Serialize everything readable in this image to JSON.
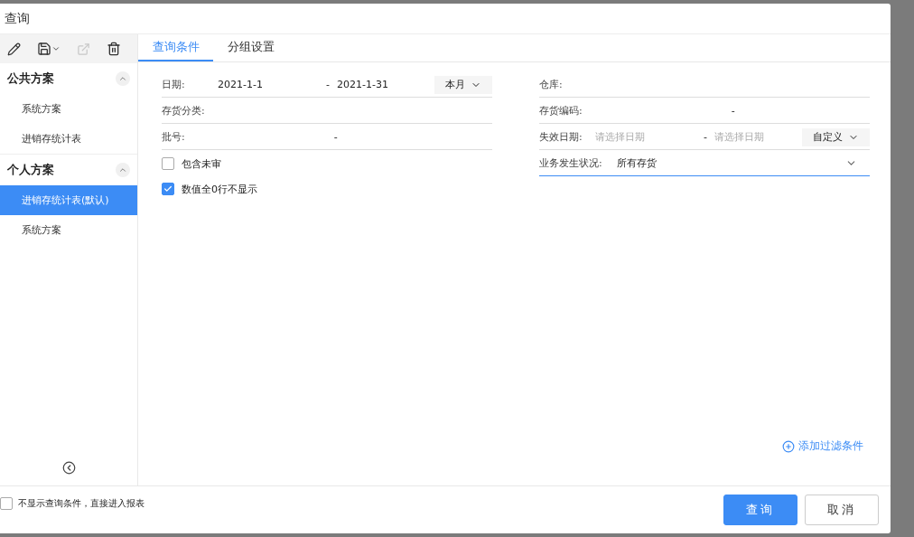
{
  "title": "查询",
  "toolbar": [
    {
      "kind": "edit",
      "disabled": false
    },
    {
      "kind": "save",
      "disabled": false
    },
    {
      "kind": "export",
      "disabled": true
    },
    {
      "kind": "delete",
      "disabled": false
    }
  ],
  "sidebar": {
    "groups": [
      {
        "title": "公共方案",
        "expanded": true,
        "items": [
          {
            "label": "系统方案",
            "selected": false
          },
          {
            "label": "进销存统计表",
            "selected": false
          }
        ]
      },
      {
        "title": "个人方案",
        "expanded": true,
        "items": [
          {
            "label": "进销存统计表(默认)",
            "selected": true
          },
          {
            "label": "系统方案",
            "selected": false
          }
        ]
      }
    ]
  },
  "tabs": [
    {
      "label": "查询条件",
      "selected": true
    },
    {
      "label": "分组设置",
      "selected": false
    }
  ],
  "left_fields": [
    {
      "kind": "range",
      "label": "日期:",
      "from": "2021-1-1",
      "separator": "-",
      "to": "2021-1-31",
      "period": "本月"
    },
    {
      "kind": "text",
      "label": "存货分类:"
    },
    {
      "kind": "range",
      "label": "批号:",
      "separator": "-"
    },
    {
      "kind": "checkbox",
      "label": "包含未审",
      "checked": false
    },
    {
      "kind": "checkbox",
      "label": "数值全0行不显示",
      "checked": true
    }
  ],
  "right_fields": [
    {
      "kind": "text",
      "label": "仓库:"
    },
    {
      "kind": "range",
      "label": "存货编码:",
      "separator": "-"
    },
    {
      "kind": "range",
      "label": "失效日期:",
      "from_placeholder": "请选择日期",
      "separator": "-",
      "to_placeholder": "请选择日期",
      "period": "自定义"
    },
    {
      "kind": "select",
      "label": "业务发生状况:",
      "value": "所有存货",
      "focused": true
    }
  ],
  "add_filter": "添加过滤条件",
  "footer": {
    "skip_option": {
      "label": "不显示查询条件，直接进入报表",
      "checked": false
    },
    "buttons": [
      {
        "label": "查询",
        "kind": "primary"
      },
      {
        "label": "取消",
        "kind": "default"
      }
    ]
  }
}
